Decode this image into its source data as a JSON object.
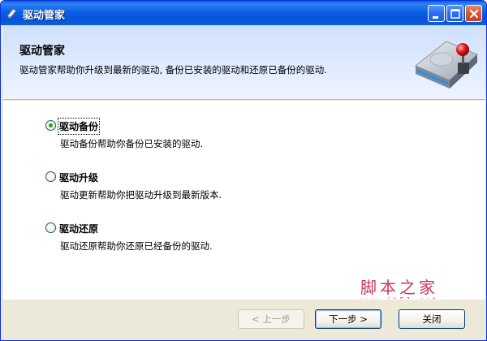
{
  "window": {
    "title": "驱动管家"
  },
  "header": {
    "title": "驱动管家",
    "description": "驱动管家帮助你升级到最新的驱动, 备份已安装的驱动和还原已备份的驱动."
  },
  "options": [
    {
      "label": "驱动备份",
      "description": "驱动备份帮助你备份已安装的驱动.",
      "selected": true
    },
    {
      "label": "驱动升级",
      "description": "驱动更新帮助你把驱动升级到最新版本.",
      "selected": false
    },
    {
      "label": "驱动还原",
      "description": "驱动还原帮助你还原已经备份的驱动.",
      "selected": false
    }
  ],
  "watermark": {
    "text": "脚本之家",
    "url": "www.jb51.net"
  },
  "buttons": {
    "back": "< 上一步",
    "next": "下一步 >",
    "close": "关闭"
  },
  "icons": {
    "app": "driver-app-icon",
    "header": "hard-drive-with-joystick-icon"
  },
  "colors": {
    "titlebar": "#0a5cdd",
    "selected_radio": "#21a121",
    "watermark": "#c8385c"
  }
}
